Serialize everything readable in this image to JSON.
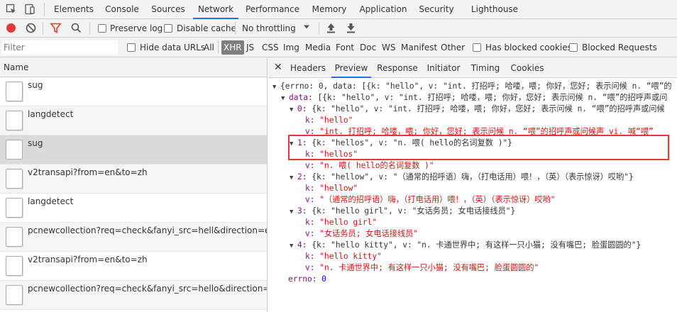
{
  "main_tabs": [
    "Elements",
    "Console",
    "Sources",
    "Network",
    "Performance",
    "Memory",
    "Application",
    "Security",
    "Lighthouse"
  ],
  "toolbar": {
    "preserve_log": "Preserve log",
    "disable_cache": "Disable cache",
    "throttling": "No throttling"
  },
  "filter": {
    "placeholder": "Filter",
    "hide_data_urls": "Hide data URLs",
    "types": [
      "All",
      "XHR",
      "JS",
      "CSS",
      "Img",
      "Media",
      "Font",
      "Doc",
      "WS",
      "Manifest",
      "Other"
    ],
    "active_type": "XHR",
    "has_blocked_cookies": "Has blocked cookies",
    "blocked_requests": "Blocked Requests"
  },
  "requests": {
    "header": "Name",
    "items": [
      "sug",
      "langdetect",
      "sug",
      "v2transapi?from=en&to=zh",
      "langdetect",
      "pcnewcollection?req=check&fanyi_src=hell&direction=en2z...",
      "v2transapi?from=en&to=zh",
      "pcnewcollection?req=check&fanyi_src=hello&direction=en2..."
    ]
  },
  "detail_tabs": [
    "Headers",
    "Preview",
    "Response",
    "Initiator",
    "Timing",
    "Cookies"
  ],
  "detail_active": "Preview",
  "preview": {
    "root": "{errno: 0, data: [{k: \"hello\", v: \"int. 打招呼; 哈喽，喂; 你好，您好; 表示问候 n. “喂”的",
    "data_key": "data",
    "data_summary": "[{k: \"hello\", v: \"int. 打招呼; 哈喽，喂; 你好，您好; 表示问候 n. “喂”的招呼声或问",
    "items": [
      {
        "index": "0",
        "summary": "{k: \"hello\", v: \"int. 打招呼; 哈喽，喂; 你好，您好; 表示问候 n. “喂”的招呼声或问候",
        "k": "\"hello\"",
        "v": "\"int. 打招呼; 哈喽，喂; 你好，您好; 表示问候 n. “喂”的招呼声或问候声 vi. 喊“喂”"
      },
      {
        "index": "1",
        "summary": "{k: \"hellos\", v: \"n. 喂( hello的名词复数 )\"}",
        "k": "\"hellos\"",
        "v": "\"n. 喂( hello的名词复数 )\""
      },
      {
        "index": "2",
        "summary": "{k: \"hellow\", v: \"（通常的招呼语）嗨，（打电话用）喂！，（英）（表示惊讶）哎哟\"}",
        "k": "\"hellow\"",
        "v": "\"（通常的招呼语）嗨，（打电话用）喂！，（英）（表示惊讶）哎哟\""
      },
      {
        "index": "3",
        "summary": "{k: \"hello girl\", v: \"女话务员; 女电话接线员\"}",
        "k": "\"hello girl\"",
        "v": "\"女话务员; 女电话接线员\""
      },
      {
        "index": "4",
        "summary": "{k: \"hello kitty\", v: \"n. 卡通世界中; 有这样一只小猫; 没有嘴巴; 脸蛋圆圆的\"}",
        "k": "\"hello kitty\"",
        "v": "\"n. 卡通世界中; 有这样一只小猫; 没有嘴巴; 脸蛋圆圆的\""
      }
    ],
    "errno_key": "errno",
    "errno_value": "0"
  },
  "colors": {
    "record": "#e53935",
    "filter_active": "#e53935",
    "tab_underline": "#1a73e8",
    "key": "#881280",
    "string": "#c41a16",
    "number": "#1c00cf",
    "highlight": "#e53935"
  },
  "icons": [
    "select-element-icon",
    "device-toolbar-icon",
    "record-icon",
    "clear-icon",
    "filter-icon",
    "search-icon",
    "dropdown-icon",
    "import-icon",
    "export-icon",
    "close-icon"
  ]
}
